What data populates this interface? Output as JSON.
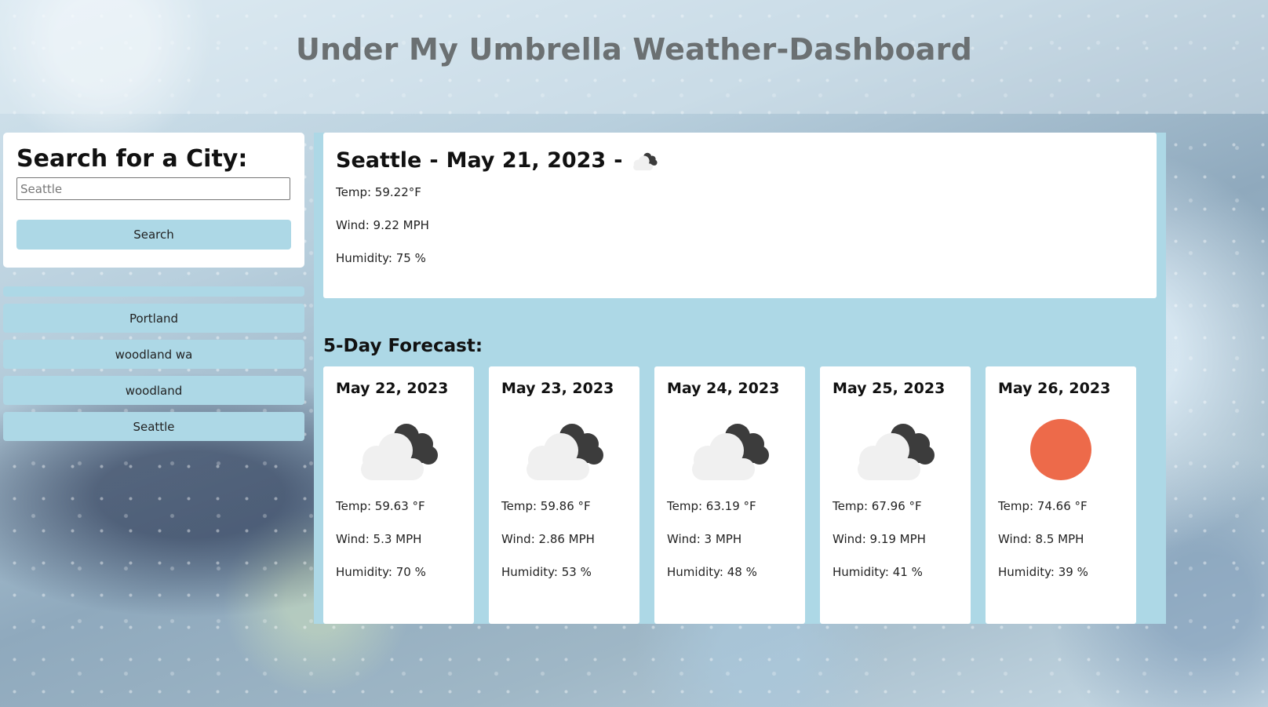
{
  "header": {
    "title": "Under My Umbrella Weather-Dashboard"
  },
  "search": {
    "heading": "Search for a City:",
    "input_value": "Seattle",
    "button_label": "Search"
  },
  "history": {
    "items": [
      {
        "label": ""
      },
      {
        "label": "Portland"
      },
      {
        "label": "woodland wa"
      },
      {
        "label": "woodland"
      },
      {
        "label": "Seattle"
      }
    ]
  },
  "current": {
    "city": "Seattle",
    "separator": "-",
    "date": "May 21, 2023",
    "icon": "broken-clouds-icon",
    "temp": "Temp: 59.22°F",
    "wind": "Wind: 9.22 MPH",
    "humidity": "Humidity: 75 %"
  },
  "forecast": {
    "title": "5-Day Forecast:",
    "days": [
      {
        "date": "May 22, 2023",
        "icon": "broken-clouds-icon",
        "temp": "Temp: 59.63 °F",
        "wind": "Wind: 5.3 MPH",
        "humidity": "Humidity: 70 %"
      },
      {
        "date": "May 23, 2023",
        "icon": "broken-clouds-icon",
        "temp": "Temp: 59.86 °F",
        "wind": "Wind: 2.86 MPH",
        "humidity": "Humidity: 53 %"
      },
      {
        "date": "May 24, 2023",
        "icon": "broken-clouds-icon",
        "temp": "Temp: 63.19 °F",
        "wind": "Wind: 3 MPH",
        "humidity": "Humidity: 48 %"
      },
      {
        "date": "May 25, 2023",
        "icon": "broken-clouds-icon",
        "temp": "Temp: 67.96 °F",
        "wind": "Wind: 9.19 MPH",
        "humidity": "Humidity: 41 %"
      },
      {
        "date": "May 26, 2023",
        "icon": "clear-sky-sun-icon",
        "temp": "Temp: 74.66 °F",
        "wind": "Wind: 8.5 MPH",
        "humidity": "Humidity: 39 %"
      }
    ]
  },
  "colors": {
    "accent": "#add8e6",
    "sun": "#ed6a4a",
    "cloud_light": "#f0f0f0",
    "cloud_dark": "#3c3c3c"
  }
}
